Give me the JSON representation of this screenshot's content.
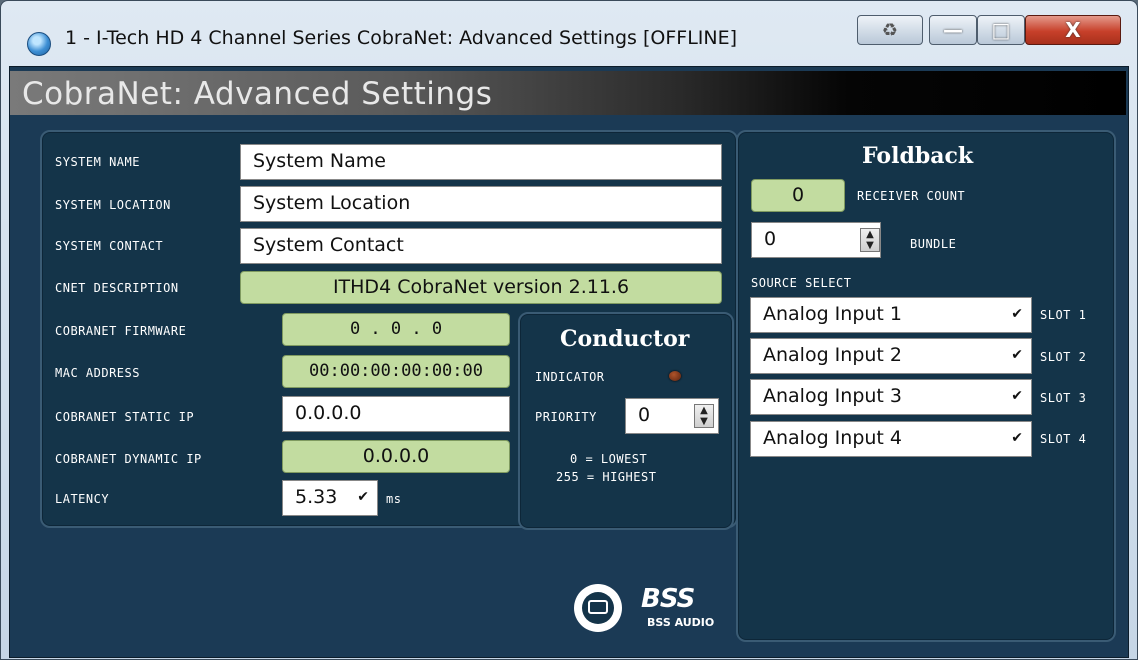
{
  "window": {
    "title": "1 - I-Tech HD 4 Channel Series CobraNet: Advanced Settings [OFFLINE]",
    "close_glyph": "X",
    "minimize_glyph": "—",
    "maximize_glyph": "□",
    "extra_glyph": "♻"
  },
  "header": {
    "title": "CobraNet: Advanced Settings"
  },
  "system": {
    "name_label": "SYSTEM NAME",
    "name_value": "System Name",
    "location_label": "SYSTEM LOCATION",
    "location_value": "System Location",
    "contact_label": "SYSTEM CONTACT",
    "contact_value": "System Contact",
    "description_label": "CNET DESCRIPTION",
    "description_value": "ITHD4 CobraNet version 2.11.6",
    "firmware_label": "COBRANET FIRMWARE",
    "firmware_value": "0 . 0 . 0",
    "mac_label": "MAC ADDRESS",
    "mac_value": "00:00:00:00:00:00",
    "static_ip_label": "COBRANET STATIC IP",
    "static_ip_value": "0.0.0.0",
    "dynamic_ip_label": "COBRANET DYNAMIC IP",
    "dynamic_ip_value": "0.0.0.0",
    "latency_label": "LATENCY",
    "latency_value": "5.33",
    "latency_unit": "ms"
  },
  "conductor": {
    "title": "Conductor",
    "indicator_label": "INDICATOR",
    "priority_label": "PRIORITY",
    "priority_value": "0",
    "lowest_note": "0 = LOWEST",
    "highest_note": "255 = HIGHEST"
  },
  "foldback": {
    "title": "Foldback",
    "receiver_count_value": "0",
    "receiver_count_label": "RECEIVER COUNT",
    "bundle_value": "0",
    "bundle_label": "BUNDLE",
    "source_select_label": "SOURCE SELECT",
    "slots": [
      {
        "value": "Analog Input 1",
        "label": "SLOT 1"
      },
      {
        "value": "Analog Input 2",
        "label": "SLOT 2"
      },
      {
        "value": "Analog Input 3",
        "label": "SLOT 3"
      },
      {
        "value": "Analog Input 4",
        "label": "SLOT 4"
      }
    ]
  },
  "logo": {
    "text": "BSS AUDIO",
    "mark": "BSS"
  },
  "colors": {
    "app_background": "#1b3a55",
    "panel": "#143449",
    "readonly_field": "#c2dca0",
    "close_button": "#c7402a"
  }
}
